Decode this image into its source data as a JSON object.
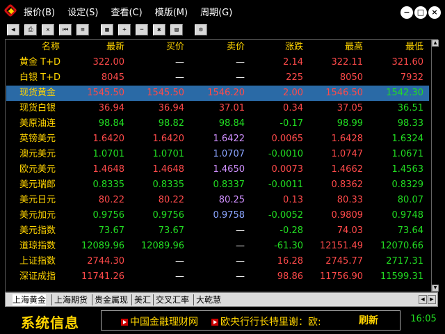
{
  "menu": {
    "items": [
      "报价(B)",
      "设定(S)",
      "查看(C)",
      "模版(M)",
      "周期(G)"
    ]
  },
  "window_buttons": [
    "minimize",
    "maximize",
    "close"
  ],
  "toolbar": {
    "icons": [
      "left-arrow-icon",
      "print-icon",
      "close-doc-icon",
      "rewind-icon",
      "list-icon",
      "calculator-icon",
      "zoom-in-icon",
      "zoom-out-icon",
      "tools-icon",
      "notes-icon",
      "settings-icon"
    ]
  },
  "table": {
    "headers": {
      "name": "名称",
      "last": "最新",
      "bid": "买价",
      "ask": "卖价",
      "change": "涨跌",
      "high": "最高",
      "low": "最低"
    },
    "rows": [
      {
        "name": "黄金 T+D",
        "last": "322.00",
        "bid": "—",
        "ask": "—",
        "change": "2.14",
        "high": "322.11",
        "low": "321.60",
        "colors": [
          "red",
          "white",
          "white",
          "red",
          "red",
          "red"
        ]
      },
      {
        "name": "白银 T+D",
        "last": "8045",
        "bid": "—",
        "ask": "—",
        "change": "225",
        "high": "8050",
        "low": "7932",
        "colors": [
          "red",
          "white",
          "white",
          "red",
          "red",
          "red"
        ]
      },
      {
        "name": "现货黄金",
        "last": "1545.50",
        "bid": "1545.50",
        "ask": "1546.20",
        "change": "2.00",
        "high": "1546.50",
        "low": "1542.30",
        "colors": [
          "red",
          "red",
          "red",
          "red",
          "red",
          "green"
        ],
        "selected": true
      },
      {
        "name": "现货白银",
        "last": "36.94",
        "bid": "36.94",
        "ask": "37.01",
        "change": "0.34",
        "high": "37.05",
        "low": "36.51",
        "colors": [
          "red",
          "red",
          "red",
          "red",
          "red",
          "green"
        ]
      },
      {
        "name": "美原油连",
        "last": "98.84",
        "bid": "98.82",
        "ask": "98.84",
        "change": "-0.17",
        "high": "98.99",
        "low": "98.33",
        "colors": [
          "green",
          "green",
          "green",
          "green",
          "green",
          "green"
        ]
      },
      {
        "name": "英镑美元",
        "last": "1.6420",
        "bid": "1.6420",
        "ask": "1.6422",
        "change": "0.0065",
        "high": "1.6428",
        "low": "1.6324",
        "colors": [
          "red",
          "red",
          "purple",
          "red",
          "red",
          "green"
        ]
      },
      {
        "name": "澳元美元",
        "last": "1.0701",
        "bid": "1.0701",
        "ask": "1.0707",
        "change": "-0.0010",
        "high": "1.0747",
        "low": "1.0671",
        "colors": [
          "green",
          "green",
          "blue",
          "green",
          "red",
          "green"
        ]
      },
      {
        "name": "欧元美元",
        "last": "1.4648",
        "bid": "1.4648",
        "ask": "1.4650",
        "change": "0.0073",
        "high": "1.4662",
        "low": "1.4563",
        "colors": [
          "red",
          "red",
          "purple",
          "red",
          "red",
          "green"
        ]
      },
      {
        "name": "美元瑞郎",
        "last": "0.8335",
        "bid": "0.8335",
        "ask": "0.8337",
        "change": "-0.0011",
        "high": "0.8362",
        "low": "0.8329",
        "colors": [
          "green",
          "green",
          "green",
          "green",
          "red",
          "green"
        ]
      },
      {
        "name": "美元日元",
        "last": "80.22",
        "bid": "80.22",
        "ask": "80.25",
        "change": "0.13",
        "high": "80.33",
        "low": "80.07",
        "colors": [
          "red",
          "red",
          "purple",
          "red",
          "red",
          "green"
        ]
      },
      {
        "name": "美元加元",
        "last": "0.9756",
        "bid": "0.9756",
        "ask": "0.9758",
        "change": "-0.0052",
        "high": "0.9809",
        "low": "0.9748",
        "colors": [
          "green",
          "green",
          "blue",
          "green",
          "red",
          "green"
        ]
      },
      {
        "name": "美元指数",
        "last": "73.67",
        "bid": "73.67",
        "ask": "—",
        "change": "-0.28",
        "high": "74.03",
        "low": "73.64",
        "colors": [
          "green",
          "green",
          "white",
          "green",
          "red",
          "green"
        ]
      },
      {
        "name": "道琼指数",
        "last": "12089.96",
        "bid": "12089.96",
        "ask": "—",
        "change": "-61.30",
        "high": "12151.49",
        "low": "12070.66",
        "colors": [
          "green",
          "green",
          "white",
          "green",
          "red",
          "green"
        ]
      },
      {
        "name": "上证指数",
        "last": "2744.30",
        "bid": "—",
        "ask": "—",
        "change": "16.28",
        "high": "2745.77",
        "low": "2717.31",
        "colors": [
          "red",
          "white",
          "white",
          "red",
          "red",
          "green"
        ]
      },
      {
        "name": "深证成指",
        "last": "11741.26",
        "bid": "—",
        "ask": "—",
        "change": "98.86",
        "high": "11756.90",
        "low": "11599.31",
        "colors": [
          "red",
          "white",
          "white",
          "red",
          "red",
          "green"
        ]
      }
    ]
  },
  "tabs": {
    "items": [
      "上海黄金",
      "上海期货",
      "贵金属现",
      "美汇",
      "交叉汇率",
      "大乾慧"
    ],
    "active": 0
  },
  "bottom": {
    "sysinfo": "系统信息",
    "ticker": [
      "中国金融理财网",
      "欧央行行长特里谢：欧:"
    ],
    "refresh": "刷新",
    "clock": "16:05"
  }
}
